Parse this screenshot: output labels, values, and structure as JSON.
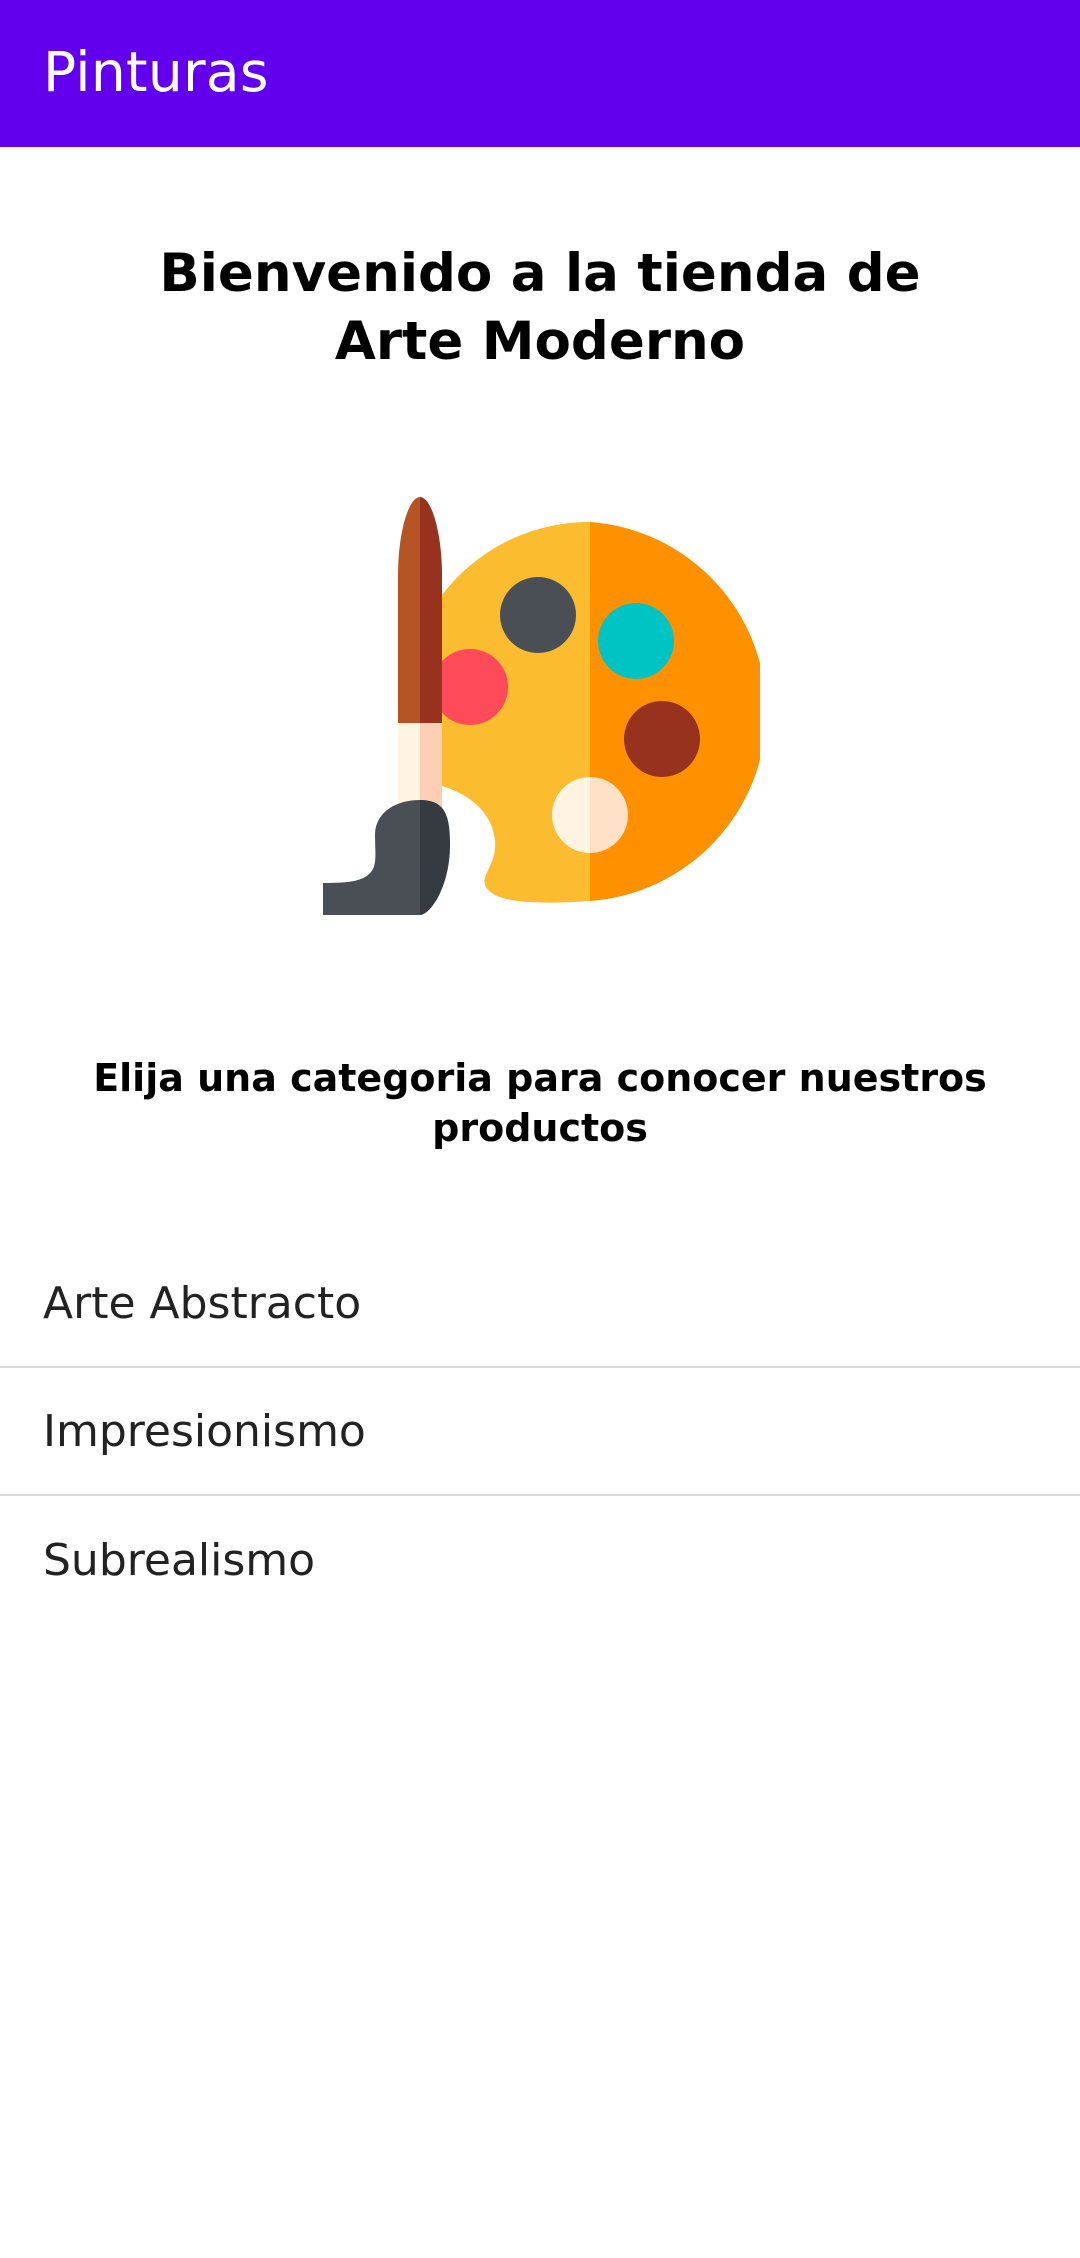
{
  "app_bar": {
    "title": "Pinturas",
    "color": "#6200EE"
  },
  "welcome": {
    "title": "Bienvenido a la tienda de Arte Moderno"
  },
  "illustration": {
    "icon": "paint-palette-with-brush-icon"
  },
  "instruction": {
    "text": "Elija una categoria para conocer nuestros productos"
  },
  "categories": [
    {
      "label": "Arte Abstracto"
    },
    {
      "label": "Impresionismo"
    },
    {
      "label": "Subrealismo"
    }
  ]
}
